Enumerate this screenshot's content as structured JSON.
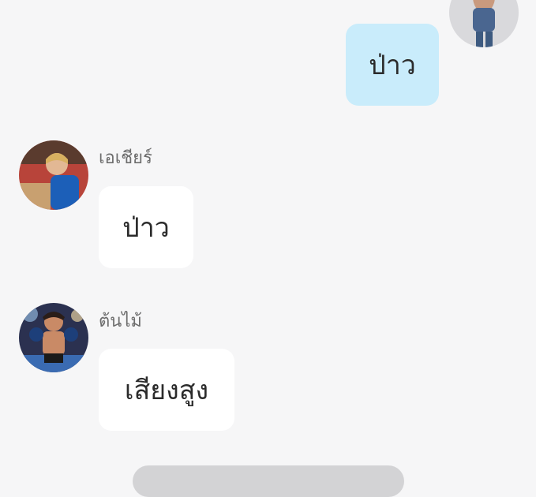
{
  "messages": [
    {
      "sender": "self",
      "sender_name": "",
      "text": "ป่าว"
    },
    {
      "sender": "other",
      "sender_name": "เอเชียร์",
      "text": "ป่าว"
    },
    {
      "sender": "other",
      "sender_name": "ต้นไม้",
      "text": "เสียงสูง"
    }
  ],
  "icons": {
    "avatar_self": "user-avatar",
    "avatar_1": "user-avatar",
    "avatar_2": "user-avatar"
  },
  "colors": {
    "background": "#f6f6f7",
    "self_bubble": "#c9ecfb",
    "other_bubble": "#ffffff"
  }
}
